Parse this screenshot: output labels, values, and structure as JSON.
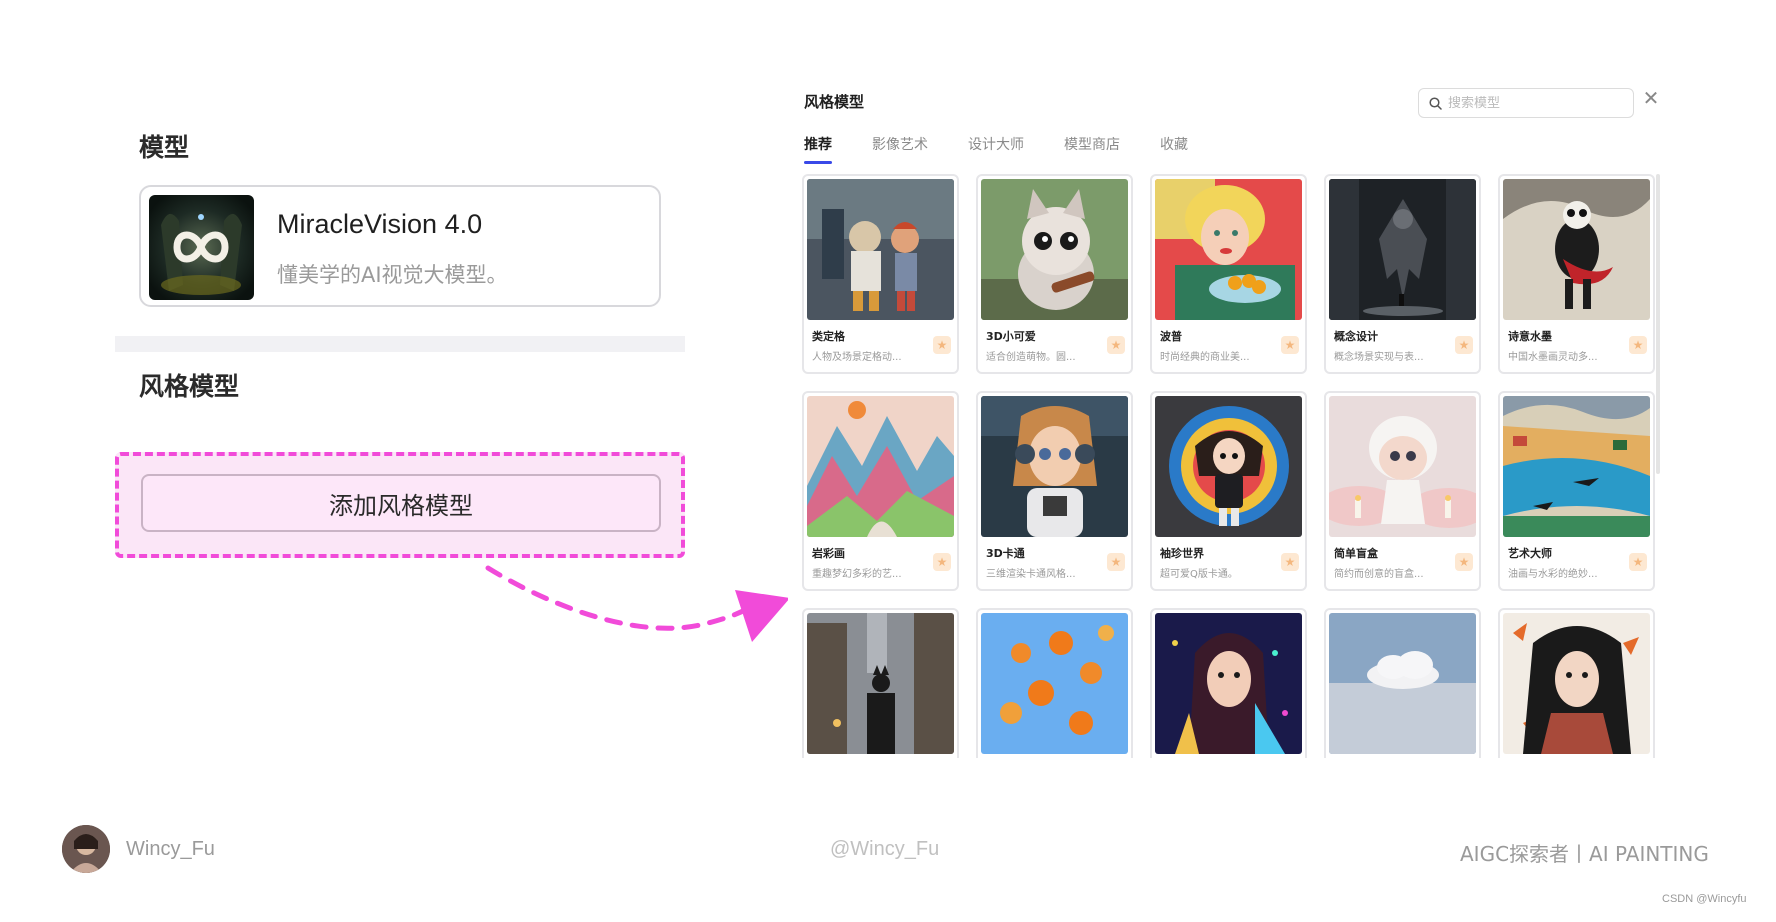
{
  "left_panel": {
    "model_section_title": "模型",
    "model_name": "MiracleVision 4.0",
    "model_desc": "懂美学的AI视觉大模型。",
    "style_section_title": "风格模型",
    "add_button_label": "添加风格模型"
  },
  "dialog": {
    "title": "风格模型",
    "search_placeholder": "搜索模型",
    "close_icon": "close-icon",
    "tabs": [
      {
        "label": "推荐",
        "active": true
      },
      {
        "label": "影像艺术",
        "active": false
      },
      {
        "label": "设计大师",
        "active": false
      },
      {
        "label": "模型商店",
        "active": false
      },
      {
        "label": "收藏",
        "active": false
      }
    ],
    "cards": [
      {
        "name": "类定格",
        "desc": "人物及场景定格动..."
      },
      {
        "name": "3D小可爱",
        "desc": "适合创造萌物。圆..."
      },
      {
        "name": "波普",
        "desc": "时尚经典的商业美..."
      },
      {
        "name": "概念设计",
        "desc": "概念场景实现与表..."
      },
      {
        "name": "诗意水墨",
        "desc": "中国水墨画灵动多..."
      },
      {
        "name": "岩彩画",
        "desc": "重趣梦幻多彩的艺..."
      },
      {
        "name": "3D卡通",
        "desc": "三维渲染卡通风格..."
      },
      {
        "name": "袖珍世界",
        "desc": "超可爱Q版卡通。"
      },
      {
        "name": "简单盲盒",
        "desc": "简约而创意的盲盒..."
      },
      {
        "name": "艺术大师",
        "desc": "油画与水彩的绝妙..."
      },
      {
        "name": "",
        "desc": ""
      },
      {
        "name": "",
        "desc": ""
      },
      {
        "name": "",
        "desc": ""
      },
      {
        "name": "",
        "desc": ""
      },
      {
        "name": "",
        "desc": ""
      }
    ]
  },
  "footer": {
    "user": "Wincy_Fu",
    "handle": "@Wincy_Fu",
    "brand": "AIGC探索者丨AI PAINTING",
    "watermark": "CSDN @Wincyfu"
  },
  "colors": {
    "accent_pink": "#f14bd9",
    "tab_underline": "#3949e8",
    "fav_icon": "#f4b77e"
  }
}
